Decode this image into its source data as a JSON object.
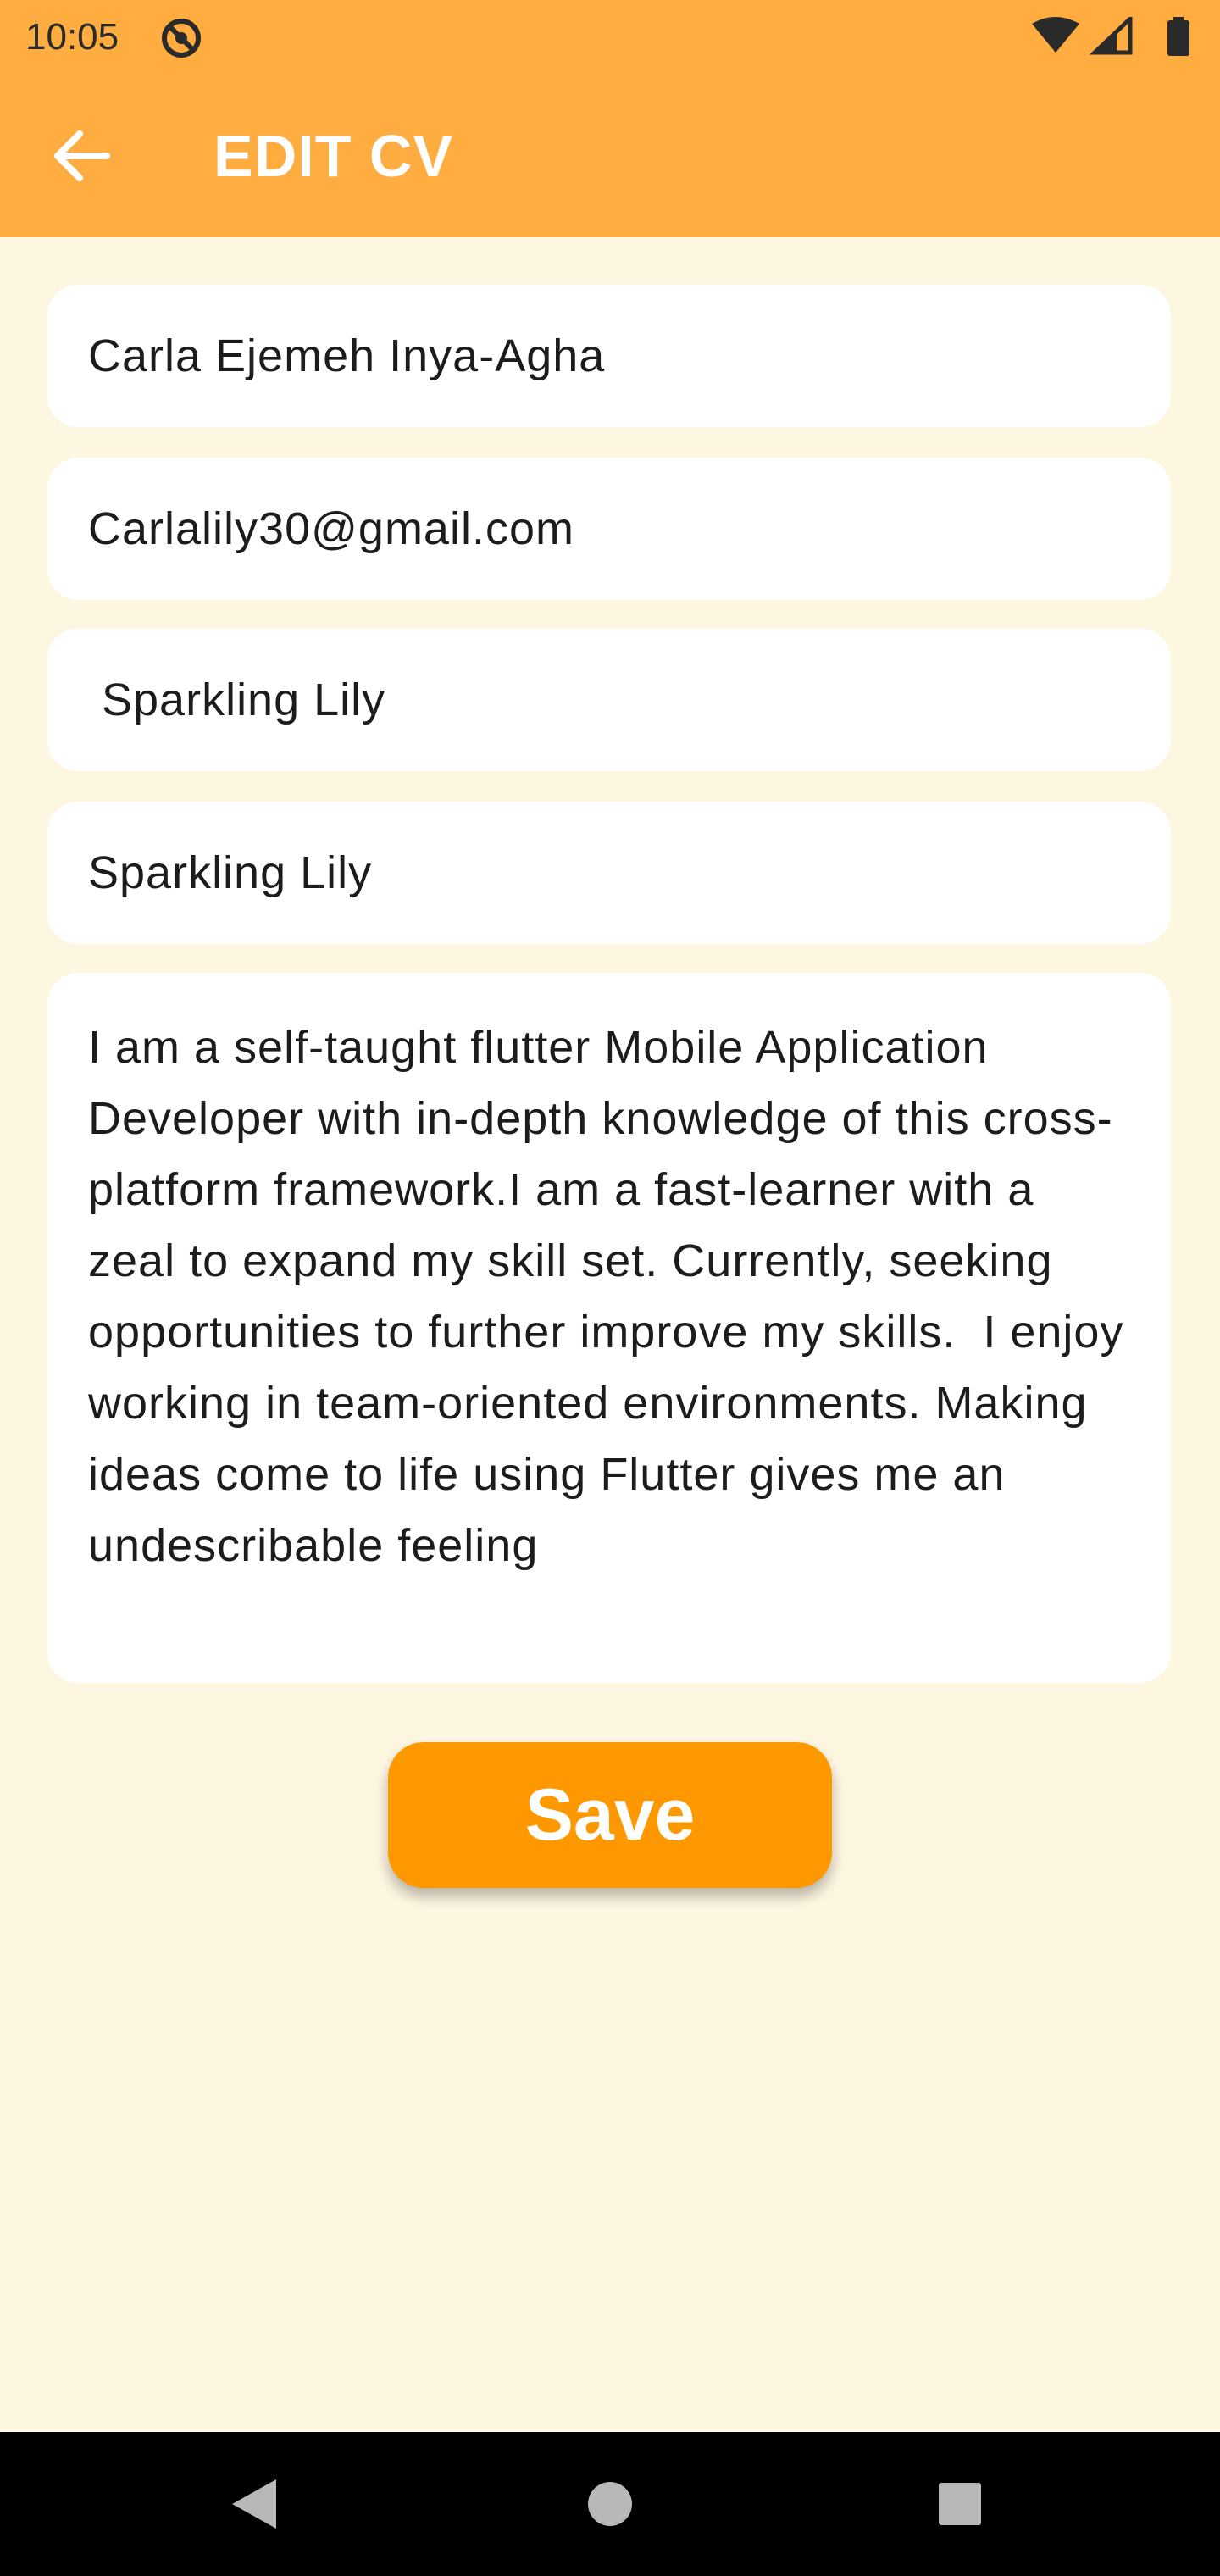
{
  "status_bar": {
    "time": "10:05",
    "icons": [
      "no-location-icon",
      "wifi-icon",
      "signal-icon",
      "battery-icon"
    ]
  },
  "app_bar": {
    "title": "EDIT CV",
    "back_icon": "arrow-back-icon",
    "background_color": "#ffac40"
  },
  "form": {
    "full_name": "Carla Ejemeh Inya-Agha",
    "email": "Carlalily30@gmail.com",
    "slack_username": " Sparkling Lily",
    "github_handle": "Sparkling Lily",
    "bio": "I am a self-taught flutter Mobile Application Developer with in-depth knowledge of this cross-platform framework.I am a fast-learner with a zeal to expand my skill set. Currently, seeking opportunities to further improve my skills.  I enjoy working in team-oriented environments. Making ideas come to life using Flutter gives me an undescribable feeling"
  },
  "save_button": {
    "label": "Save",
    "color": "#fd9800"
  },
  "nav_bar": {
    "icons": [
      "back-triangle-icon",
      "home-circle-icon",
      "recents-square-icon"
    ]
  },
  "theme": {
    "page_background": "#fdf6e1",
    "field_background": "#ffffff"
  }
}
